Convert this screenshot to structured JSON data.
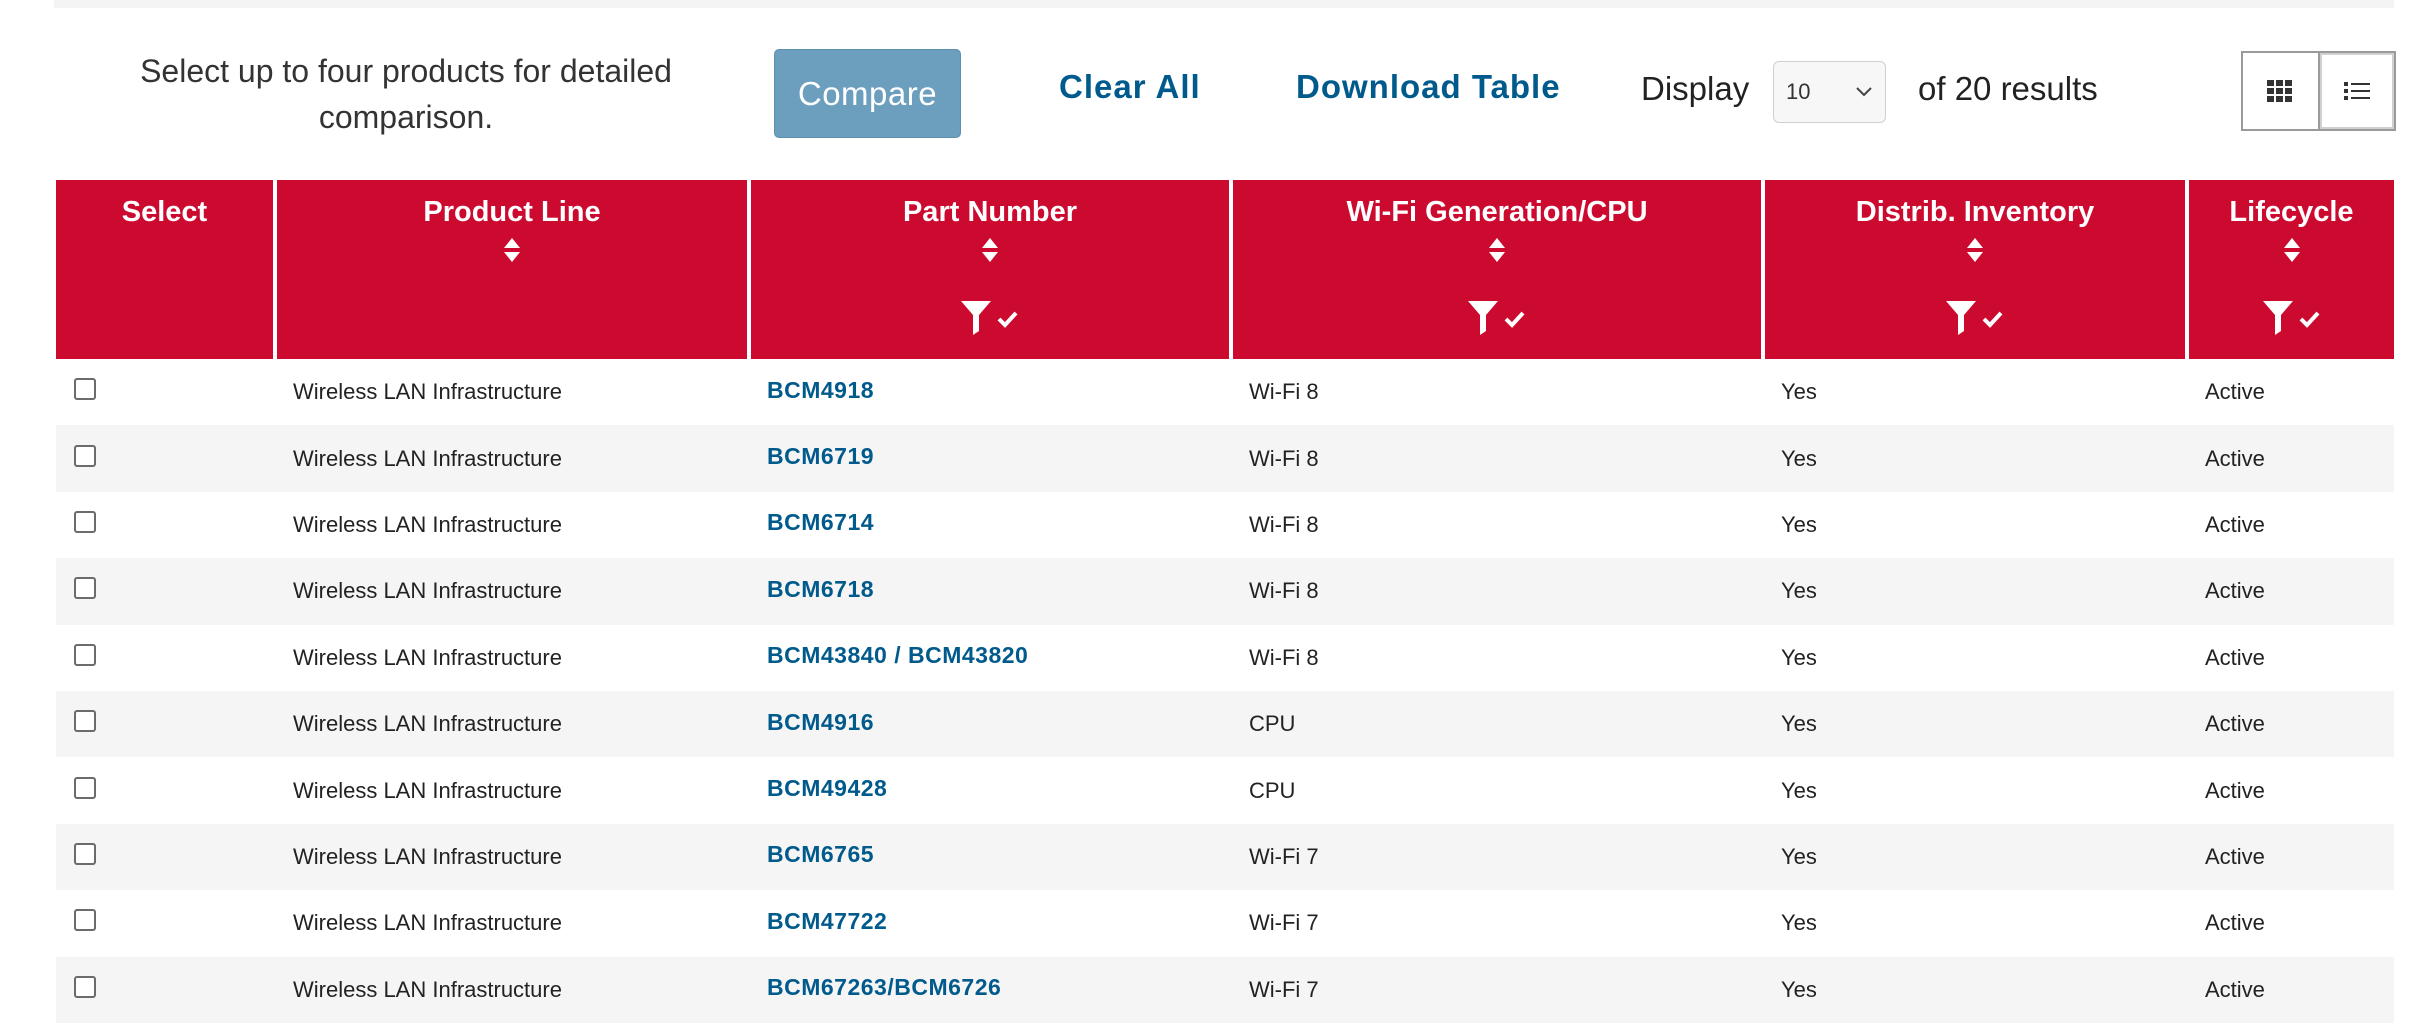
{
  "toolbar": {
    "intro_text": "Select up to four products for detailed comparison.",
    "compare_label": "Compare",
    "clear_all_label": "Clear All",
    "download_label": "Download Table",
    "display_label": "Display",
    "display_value": "10",
    "results_label": "of 20 results",
    "view_modes": [
      {
        "icon": "grid-icon",
        "active": false
      },
      {
        "icon": "list-icon",
        "active": true
      }
    ]
  },
  "colors": {
    "header_red": "#cc0a2f",
    "link_blue": "#005a8c",
    "compare_button": "#6b9fbd"
  },
  "table": {
    "columns": [
      {
        "label": "Select",
        "sortable": false,
        "filterable": false
      },
      {
        "label": "Product Line",
        "sortable": true,
        "filterable": false
      },
      {
        "label": "Part Number",
        "sortable": true,
        "filterable": true
      },
      {
        "label": "Wi-Fi Generation/CPU",
        "sortable": true,
        "filterable": true
      },
      {
        "label": "Distrib. Inventory",
        "sortable": true,
        "filterable": true
      },
      {
        "label": "Lifecycle",
        "sortable": true,
        "filterable": true
      }
    ],
    "rows": [
      {
        "product_line": "Wireless LAN Infrastructure",
        "part_number": "BCM4918",
        "generation": "Wi-Fi 8",
        "inventory": "Yes",
        "lifecycle": "Active",
        "checked": false
      },
      {
        "product_line": "Wireless LAN Infrastructure",
        "part_number": "BCM6719",
        "generation": "Wi-Fi 8",
        "inventory": "Yes",
        "lifecycle": "Active",
        "checked": false
      },
      {
        "product_line": "Wireless LAN Infrastructure",
        "part_number": "BCM6714",
        "generation": "Wi-Fi 8",
        "inventory": "Yes",
        "lifecycle": "Active",
        "checked": false
      },
      {
        "product_line": "Wireless LAN Infrastructure",
        "part_number": "BCM6718",
        "generation": "Wi-Fi 8",
        "inventory": "Yes",
        "lifecycle": "Active",
        "checked": false
      },
      {
        "product_line": "Wireless LAN Infrastructure",
        "part_number": "BCM43840 / BCM43820",
        "generation": "Wi-Fi 8",
        "inventory": "Yes",
        "lifecycle": "Active",
        "checked": false
      },
      {
        "product_line": "Wireless LAN Infrastructure",
        "part_number": "BCM4916",
        "generation": "CPU",
        "inventory": "Yes",
        "lifecycle": "Active",
        "checked": false
      },
      {
        "product_line": "Wireless LAN Infrastructure",
        "part_number": "BCM49428",
        "generation": "CPU",
        "inventory": "Yes",
        "lifecycle": "Active",
        "checked": false
      },
      {
        "product_line": "Wireless LAN Infrastructure",
        "part_number": "BCM6765",
        "generation": "Wi-Fi 7",
        "inventory": "Yes",
        "lifecycle": "Active",
        "checked": false
      },
      {
        "product_line": "Wireless LAN Infrastructure",
        "part_number": "BCM47722",
        "generation": "Wi-Fi 7",
        "inventory": "Yes",
        "lifecycle": "Active",
        "checked": false
      },
      {
        "product_line": "Wireless LAN Infrastructure",
        "part_number": "BCM67263/BCM6726",
        "generation": "Wi-Fi 7",
        "inventory": "Yes",
        "lifecycle": "Active",
        "checked": false
      }
    ]
  }
}
